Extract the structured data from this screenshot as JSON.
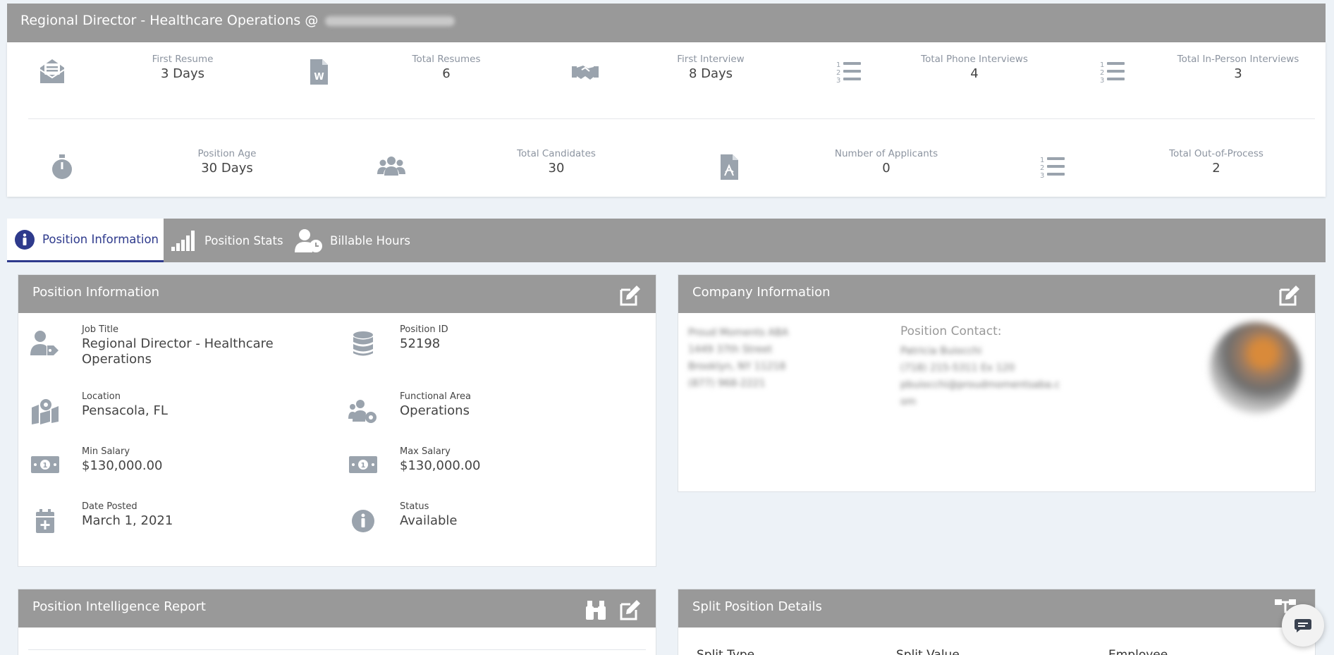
{
  "header": {
    "title": "Regional Director - Healthcare Operations @"
  },
  "stats_row1": [
    {
      "label": "First Resume",
      "value": "3 Days",
      "icon": "envelope-open-icon"
    },
    {
      "label": "Total Resumes",
      "value": "6",
      "icon": "word-file-icon"
    },
    {
      "label": "First Interview",
      "value": "8 Days",
      "icon": "handshake-icon"
    },
    {
      "label": "Total Phone Interviews",
      "value": "4",
      "icon": "ordered-list-icon"
    },
    {
      "label": "Total In-Person Interviews",
      "value": "3",
      "icon": "ordered-list-icon"
    }
  ],
  "stats_row2": [
    {
      "label": "Position Age",
      "value": "30 Days",
      "icon": "stopwatch-icon"
    },
    {
      "label": "Total Candidates",
      "value": "30",
      "icon": "users-icon"
    },
    {
      "label": "Number of Applicants",
      "value": "0",
      "icon": "pdf-file-icon"
    },
    {
      "label": "Total Out-of-Process",
      "value": "2",
      "icon": "ordered-list-icon"
    }
  ],
  "tabs": [
    {
      "label": "Position Information",
      "active": true
    },
    {
      "label": "Position Stats",
      "active": false
    },
    {
      "label": "Billable Hours",
      "active": false
    }
  ],
  "position_info": {
    "title": "Position Information",
    "fields": [
      {
        "label": "Job Title",
        "value": "Regional Director - Healthcare Operations"
      },
      {
        "label": "Position ID",
        "value": "52198"
      },
      {
        "label": "Location",
        "value": "Pensacola, FL"
      },
      {
        "label": "Functional Area",
        "value": "Operations"
      },
      {
        "label": "Min Salary",
        "value": "$130,000.00"
      },
      {
        "label": "Max Salary",
        "value": "$130,000.00"
      },
      {
        "label": "Date Posted",
        "value": "March 1, 2021"
      },
      {
        "label": "Status",
        "value": "Available"
      }
    ]
  },
  "company_info": {
    "title": "Company Information",
    "address_lines": [
      "Proud Moments ABA",
      "1449 37th Street",
      "Brooklyn, NY 11218",
      "(877) 968-2221"
    ],
    "contact_label": "Position Contact:",
    "contact_lines": [
      "Patricia Buiocchi",
      "(718) 215-5311 Ex 120",
      "pbuiocchi@proudmomentsaba.c",
      "om"
    ]
  },
  "intel_report": {
    "title": "Position Intelligence Report"
  },
  "split_details": {
    "title": "Split Position Details",
    "columns": [
      "Split Type",
      "Split Value",
      "Employee"
    ]
  }
}
